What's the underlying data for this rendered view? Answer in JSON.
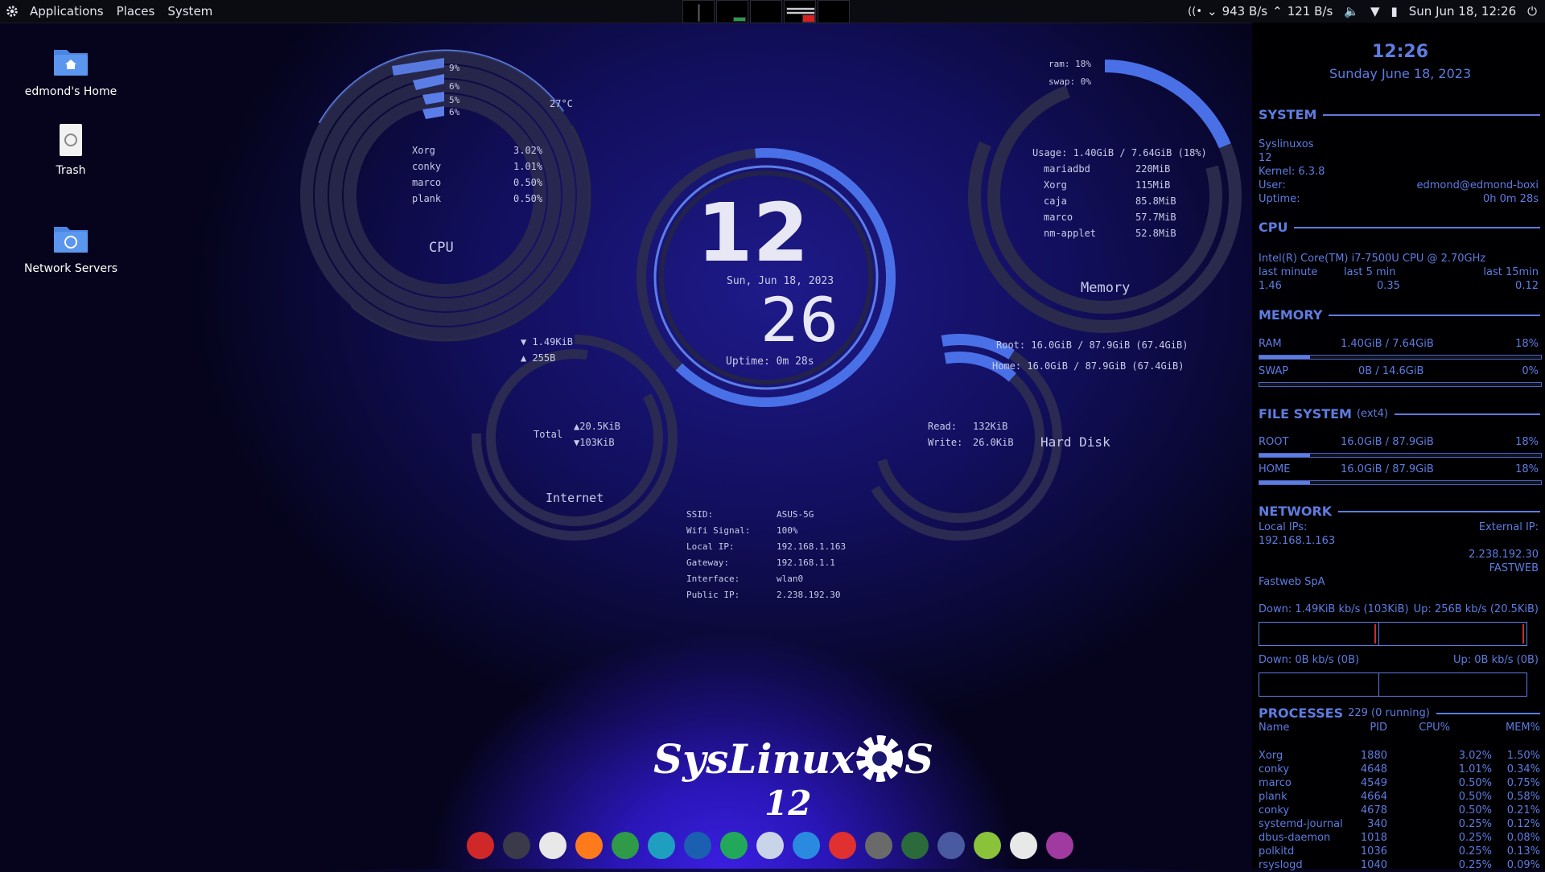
{
  "top_panel": {
    "menus": [
      "Applications",
      "Places",
      "System"
    ],
    "net_down": "943 B/s",
    "net_up": "121 B/s",
    "clock": "Sun Jun 18, 12:26"
  },
  "desktop": {
    "icons": [
      {
        "label": "edmond's Home",
        "icon": "home-folder-icon"
      },
      {
        "label": "Trash",
        "icon": "trash-icon"
      },
      {
        "label": "Network Servers",
        "icon": "network-folder-icon"
      }
    ]
  },
  "cpu_widget": {
    "title": "CPU",
    "temp": "27°C",
    "cores": [
      "9%",
      "6%",
      "5%",
      "6%"
    ],
    "processes": [
      {
        "name": "Xorg",
        "value": "3.02%"
      },
      {
        "name": "conky",
        "value": "1.01%"
      },
      {
        "name": "marco",
        "value": "0.50%"
      },
      {
        "name": "plank",
        "value": "0.50%"
      }
    ]
  },
  "clock_widget": {
    "hour": "12",
    "minute": "26",
    "date": "Sun, Jun 18, 2023",
    "uptime": "Uptime: 0m 28s"
  },
  "memory_widget": {
    "title": "Memory",
    "ram": "ram: 18%",
    "swap": "swap: 0%",
    "usage": "Usage: 1.40GiB / 7.64GiB (18%)",
    "processes": [
      {
        "name": "mariadbd",
        "value": "220MiB"
      },
      {
        "name": "Xorg",
        "value": "115MiB"
      },
      {
        "name": "caja",
        "value": "85.8MiB"
      },
      {
        "name": "marco",
        "value": "57.7MiB"
      },
      {
        "name": "nm-applet",
        "value": "52.8MiB"
      }
    ]
  },
  "internet_widget": {
    "title": "Internet",
    "down": "▼ 1.49KiB",
    "up": "▲ 255B",
    "total_label": "Total",
    "total_up": "▲20.5KiB",
    "total_down": "▼103KiB"
  },
  "disk_widget": {
    "title": "Hard Disk",
    "root": "Root: 16.0GiB / 87.9GiB (67.4GiB)",
    "home": "Home: 16.0GiB / 87.9GiB (67.4GiB)",
    "read_label": "Read:",
    "read": "132KiB",
    "write_label": "Write:",
    "write": "26.0KiB"
  },
  "network_info": [
    {
      "key": "SSID:",
      "value": "ASUS-5G"
    },
    {
      "key": "Wifi Signal:",
      "value": "100%"
    },
    {
      "key": "Local IP:",
      "value": "192.168.1.163"
    },
    {
      "key": "Gateway:",
      "value": "192.168.1.1"
    },
    {
      "key": "Interface:",
      "value": "wlan0"
    },
    {
      "key": "Public IP:",
      "value": "2.238.192.30"
    }
  ],
  "logo": {
    "text_left": "SysLinux",
    "text_right": "S",
    "version": "12"
  },
  "sidebar": {
    "time": "12:26",
    "date": "Sunday June 18, 2023",
    "system": {
      "title": "SYSTEM",
      "distro": "Syslinuxos",
      "version": "12",
      "kernel": "Kernel: 6.3.8",
      "user_label": "User:",
      "user": "edmond@edmond-boxi",
      "uptime_label": "Uptime:",
      "uptime": "0h 0m 28s"
    },
    "cpu": {
      "title": "CPU",
      "model": "Intel(R) Core(TM) i7-7500U CPU @ 2.70GHz",
      "l1": "last minute",
      "l5": "last 5 min",
      "l15": "last 15min",
      "v1": "1.46",
      "v5": "0.35",
      "v15": "0.12"
    },
    "memory": {
      "title": "MEMORY",
      "ram_label": "RAM",
      "ram_value": "1.40GiB / 7.64GiB",
      "ram_pct": "18%",
      "ram_frac": 0.18,
      "swap_label": "SWAP",
      "swap_value": "0B / 14.6GiB",
      "swap_pct": "0%",
      "swap_frac": 0.0
    },
    "filesystem": {
      "title": "FILE SYSTEM",
      "type": "(ext4)",
      "root_label": "ROOT",
      "root_value": "16.0GiB / 87.9GiB",
      "root_pct": "18%",
      "root_frac": 0.18,
      "home_label": "HOME",
      "home_value": "16.0GiB / 87.9GiB",
      "home_pct": "18%",
      "home_frac": 0.18
    },
    "network": {
      "title": "NETWORK",
      "local_label": "Local IPs:",
      "local_ip": "192.168.1.163",
      "ext_label": "External IP:",
      "ext_ip": "2.238.192.30",
      "isp_short": "FASTWEB",
      "isp": "Fastweb SpA",
      "down1": "Down: 1.49KiB kb/s (103KiB)",
      "up1": "Up: 256B kb/s (20.5KiB)",
      "down2": "Down: 0B kb/s (0B)",
      "up2": "Up: 0B kb/s (0B)"
    },
    "processes": {
      "title": "PROCESSES",
      "count": "229 (0 running)",
      "columns": [
        "Name",
        "PID",
        "CPU%",
        "MEM%"
      ],
      "rows": [
        [
          "Xorg",
          "1880",
          "3.02%",
          "1.50%"
        ],
        [
          "conky",
          "4648",
          "1.01%",
          "0.34%"
        ],
        [
          "marco",
          "4549",
          "0.50%",
          "0.75%"
        ],
        [
          "plank",
          "4664",
          "0.50%",
          "0.58%"
        ],
        [
          "conky",
          "4678",
          "0.50%",
          "0.21%"
        ],
        [
          "systemd-journal",
          "340",
          "0.25%",
          "0.12%"
        ],
        [
          "dbus-daemon",
          "1018",
          "0.25%",
          "0.08%"
        ],
        [
          "polkitd",
          "1036",
          "0.25%",
          "0.13%"
        ],
        [
          "rsyslogd",
          "1040",
          "0.25%",
          "0.09%"
        ]
      ]
    }
  },
  "dock": [
    {
      "icon": "terminal-red-icon",
      "color": "#d02828"
    },
    {
      "icon": "keyboard-icon",
      "color": "#3a3a4a"
    },
    {
      "icon": "remote-desktop-icon",
      "color": "#e8e8e8"
    },
    {
      "icon": "firefox-icon",
      "color": "#ff7a1a"
    },
    {
      "icon": "chrome-icon",
      "color": "#2f9a48"
    },
    {
      "icon": "edge-dev-icon",
      "color": "#1f9fc0"
    },
    {
      "icon": "wave-app-icon",
      "color": "#1b5fb0"
    },
    {
      "icon": "lightning-app-icon",
      "color": "#22a85a"
    },
    {
      "icon": "wifi-tool-icon",
      "color": "#c9d4e8"
    },
    {
      "icon": "chat-app-icon",
      "color": "#2a8ae0"
    },
    {
      "icon": "anydesk-icon",
      "color": "#e03030"
    },
    {
      "icon": "disk-utility-icon",
      "color": "#6a6a6a"
    },
    {
      "icon": "package-manager-icon",
      "color": "#2b6a3a"
    },
    {
      "icon": "gimp-icon",
      "color": "#4a5aa0"
    },
    {
      "icon": "box-app-icon",
      "color": "#8ac23a"
    },
    {
      "icon": "obs-icon",
      "color": "#e8e8e8"
    },
    {
      "icon": "podcast-app-icon",
      "color": "#a03aa0"
    }
  ]
}
